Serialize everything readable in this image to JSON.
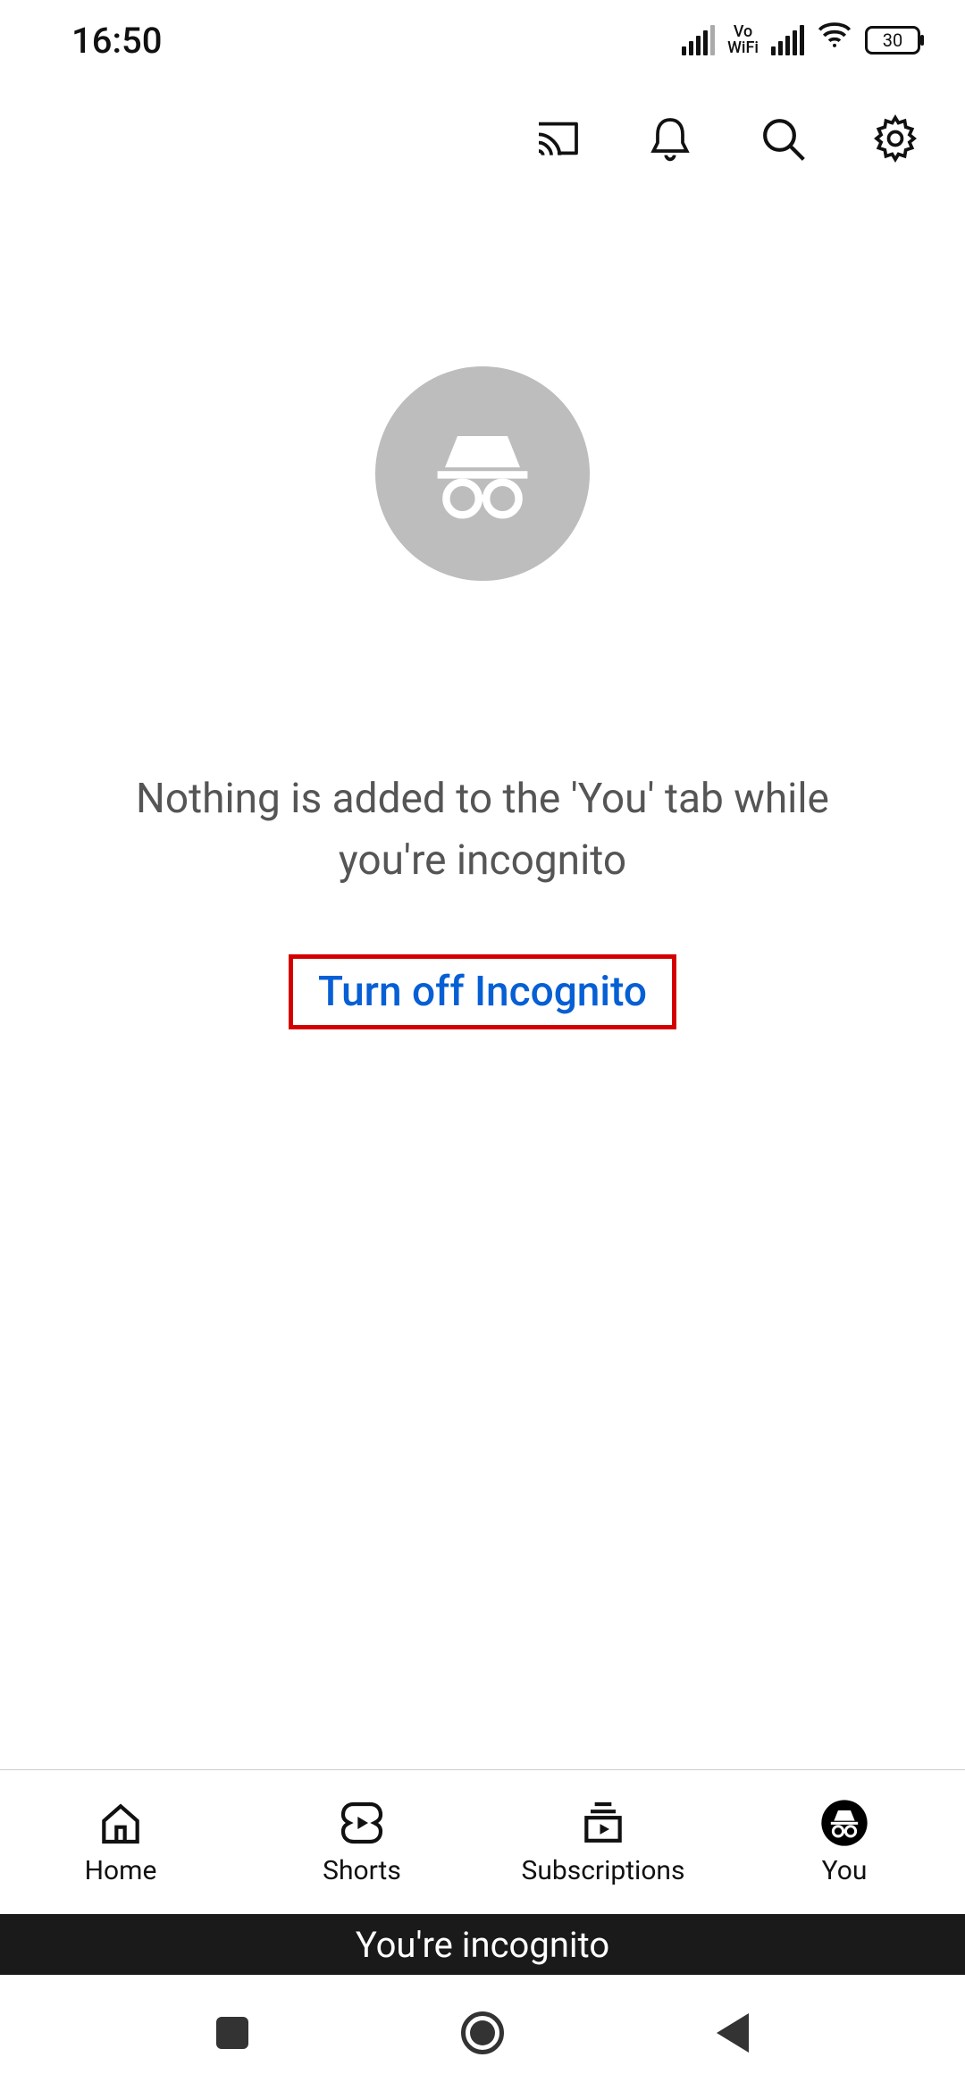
{
  "status": {
    "time": "16:50",
    "vowifi_top": "Vo",
    "vowifi_bottom": "WiFi",
    "battery_pct": "30"
  },
  "main": {
    "message": "Nothing is added to the 'You' tab while you're incognito",
    "turn_off_label": "Turn off Incognito"
  },
  "bottom_nav": {
    "tabs": [
      {
        "label": "Home"
      },
      {
        "label": "Shorts"
      },
      {
        "label": "Subscriptions"
      },
      {
        "label": "You"
      }
    ]
  },
  "banner": {
    "text": "You're incognito"
  }
}
